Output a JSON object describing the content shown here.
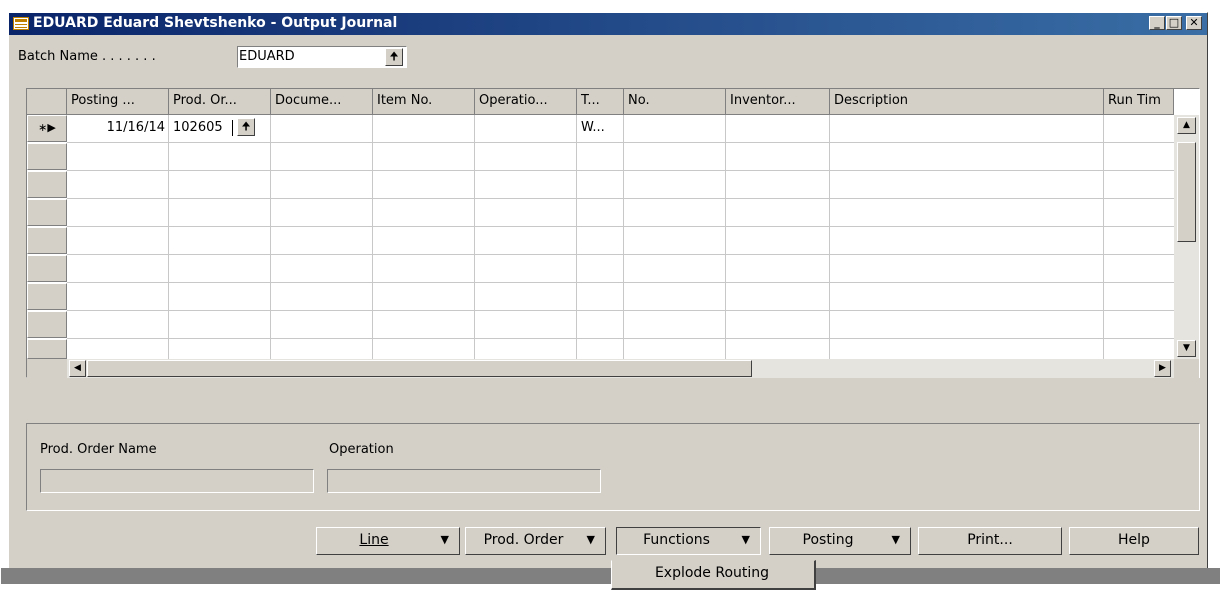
{
  "window": {
    "title": "EDUARD Eduard Shevtshenko - Output Journal",
    "controls": [
      "minimize-icon",
      "maximize-icon",
      "close-icon"
    ]
  },
  "batch": {
    "label": "Batch Name . . . . . . .",
    "value": "EDUARD"
  },
  "grid": {
    "columns": [
      "Posting ...",
      "Prod. Or...",
      "Docume...",
      "Item No.",
      "Operatio...",
      "T...",
      "No.",
      "Inventor...",
      "Description",
      "Run Tim"
    ],
    "row": {
      "indicator": "∗▶",
      "posting_date": "11/16/14",
      "prod_order": "102605",
      "type": "W..."
    }
  },
  "info": {
    "prod_order_name_label": "Prod. Order Name",
    "operation_label": "Operation"
  },
  "buttons": {
    "line": "Line",
    "prod_order": "Prod. Order",
    "functions": "Functions",
    "posting": "Posting",
    "print": "Print...",
    "help": "Help"
  },
  "menu": {
    "explode_routing": "Explode Routing"
  }
}
